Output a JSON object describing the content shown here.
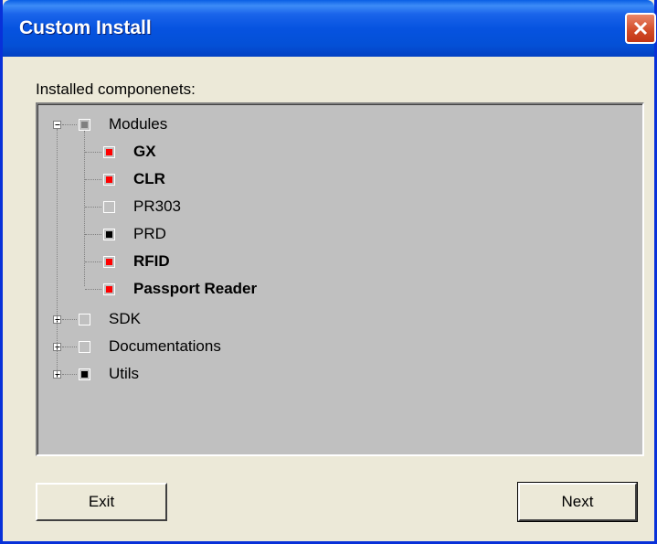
{
  "window": {
    "title": "Custom Install"
  },
  "installed_label": "Installed componenets:",
  "tree": {
    "root": {
      "label": "Modules",
      "expanded": true,
      "check_color": "#808080"
    },
    "modules": [
      {
        "label": "GX",
        "bold": true,
        "check_color": "#ff0000"
      },
      {
        "label": "CLR",
        "bold": true,
        "check_color": "#ff0000"
      },
      {
        "label": "PR303",
        "bold": false,
        "check_color": "#c0c0c0"
      },
      {
        "label": "PRD",
        "bold": false,
        "check_color": "#000000"
      },
      {
        "label": "RFID",
        "bold": true,
        "check_color": "#ff0000"
      },
      {
        "label": "Passport Reader",
        "bold": true,
        "check_color": "#ff0000"
      }
    ],
    "groups": [
      {
        "label": "SDK",
        "expanded": false,
        "check_color": "#c0c0c0"
      },
      {
        "label": "Documentations",
        "expanded": false,
        "check_color": "#c0c0c0"
      },
      {
        "label": "Utils",
        "expanded": false,
        "check_color": "#000000"
      }
    ]
  },
  "buttons": {
    "exit": "Exit",
    "next": "Next"
  }
}
